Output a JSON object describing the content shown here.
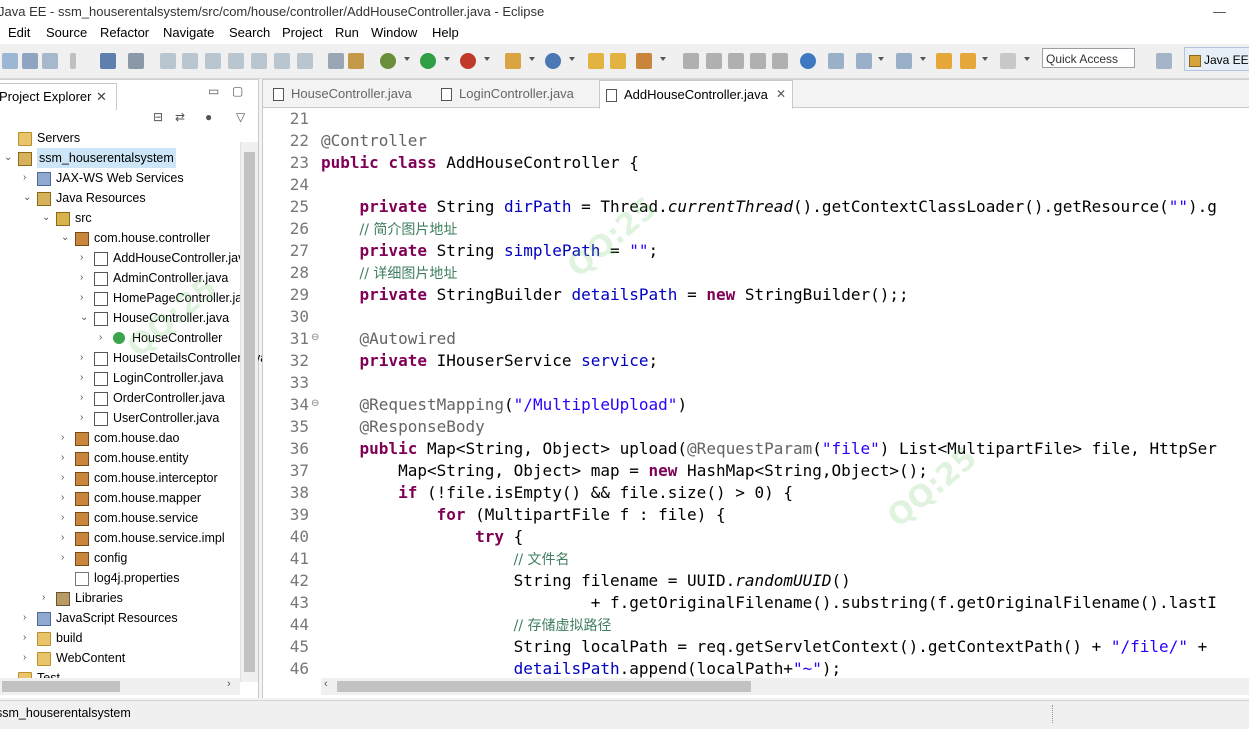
{
  "window": {
    "title": "Java EE - ssm_houserentalsystem/src/com/house/controller/AddHouseController.java - Eclipse"
  },
  "menu": [
    "Edit",
    "Source",
    "Refactor",
    "Navigate",
    "Search",
    "Project",
    "Run",
    "Window",
    "Help"
  ],
  "toolbar": {
    "quick_access_placeholder": "Quick Access",
    "perspective_label": "Java EE"
  },
  "project_explorer": {
    "tab_label": "Project Explorer",
    "tree": [
      {
        "label": "Servers",
        "icon": "folder-icon",
        "depth": 0,
        "expanded": null
      },
      {
        "label": "ssm_houserentalsystem",
        "icon": "project-icon",
        "depth": 0,
        "expanded": true,
        "selected": true
      },
      {
        "label": "JAX-WS Web Services",
        "icon": "webservices-icon",
        "depth": 1,
        "expanded": false
      },
      {
        "label": "Java Resources",
        "icon": "java-resources-icon",
        "depth": 1,
        "expanded": true
      },
      {
        "label": "src",
        "icon": "source-folder-icon",
        "depth": 2,
        "expanded": true
      },
      {
        "label": "com.house.controller",
        "icon": "package-icon",
        "depth": 3,
        "expanded": true
      },
      {
        "label": "AddHouseController.java",
        "icon": "java-file-icon",
        "depth": 4,
        "expanded": false
      },
      {
        "label": "AdminController.java",
        "icon": "java-file-icon",
        "depth": 4,
        "expanded": false
      },
      {
        "label": "HomePageController.java",
        "icon": "java-file-icon",
        "depth": 4,
        "expanded": false
      },
      {
        "label": "HouseController.java",
        "icon": "java-file-icon",
        "depth": 4,
        "expanded": true
      },
      {
        "label": "HouseController",
        "icon": "class-icon",
        "depth": 5,
        "expanded": false
      },
      {
        "label": "HouseDetailsController.java",
        "icon": "java-file-icon",
        "depth": 4,
        "expanded": false
      },
      {
        "label": "LoginController.java",
        "icon": "java-file-icon",
        "depth": 4,
        "expanded": false
      },
      {
        "label": "OrderController.java",
        "icon": "java-file-icon",
        "depth": 4,
        "expanded": false
      },
      {
        "label": "UserController.java",
        "icon": "java-file-icon",
        "depth": 4,
        "expanded": false
      },
      {
        "label": "com.house.dao",
        "icon": "package-icon",
        "depth": 3,
        "expanded": false
      },
      {
        "label": "com.house.entity",
        "icon": "package-icon",
        "depth": 3,
        "expanded": false
      },
      {
        "label": "com.house.interceptor",
        "icon": "package-icon",
        "depth": 3,
        "expanded": false
      },
      {
        "label": "com.house.mapper",
        "icon": "package-icon",
        "depth": 3,
        "expanded": false
      },
      {
        "label": "com.house.service",
        "icon": "package-icon",
        "depth": 3,
        "expanded": false
      },
      {
        "label": "com.house.service.impl",
        "icon": "package-icon",
        "depth": 3,
        "expanded": false
      },
      {
        "label": "config",
        "icon": "package-icon",
        "depth": 3,
        "expanded": false
      },
      {
        "label": "log4j.properties",
        "icon": "properties-file-icon",
        "depth": 3,
        "expanded": null
      },
      {
        "label": "Libraries",
        "icon": "library-icon",
        "depth": 2,
        "expanded": false
      },
      {
        "label": "JavaScript Resources",
        "icon": "javascript-resources-icon",
        "depth": 1,
        "expanded": false
      },
      {
        "label": "build",
        "icon": "folder-icon",
        "depth": 1,
        "expanded": false
      },
      {
        "label": "WebContent",
        "icon": "folder-icon",
        "depth": 1,
        "expanded": false
      },
      {
        "label": "Test",
        "icon": "folder-icon",
        "depth": 0,
        "expanded": null
      }
    ]
  },
  "editor": {
    "tabs": [
      {
        "label": "HouseController.java",
        "active": false
      },
      {
        "label": "LoginController.java",
        "active": false
      },
      {
        "label": "AddHouseController.java",
        "active": true
      }
    ],
    "lines": [
      {
        "n": "21",
        "fold": false,
        "tokens": []
      },
      {
        "n": "22",
        "fold": false,
        "tokens": [
          {
            "t": "an",
            "v": "@Controller"
          }
        ]
      },
      {
        "n": "23",
        "fold": false,
        "tokens": [
          {
            "t": "kw",
            "v": "public"
          },
          {
            "t": "",
            "v": " "
          },
          {
            "t": "kw",
            "v": "class"
          },
          {
            "t": "",
            "v": " AddHouseController {"
          }
        ]
      },
      {
        "n": "24",
        "fold": false,
        "tokens": []
      },
      {
        "n": "25",
        "fold": false,
        "tokens": [
          {
            "t": "",
            "v": "    "
          },
          {
            "t": "kw",
            "v": "private"
          },
          {
            "t": "",
            "v": " String "
          },
          {
            "t": "fd",
            "v": "dirPath"
          },
          {
            "t": "",
            "v": " = Thread."
          },
          {
            "t": "it",
            "v": "currentThread"
          },
          {
            "t": "",
            "v": "().getContextClassLoader().getResource("
          },
          {
            "t": "st",
            "v": "\"\""
          },
          {
            "t": "",
            "v": ").g"
          }
        ]
      },
      {
        "n": "26",
        "fold": false,
        "tokens": [
          {
            "t": "",
            "v": "    "
          },
          {
            "t": "cm",
            "v": "// 简介图片地址"
          }
        ]
      },
      {
        "n": "27",
        "fold": false,
        "tokens": [
          {
            "t": "",
            "v": "    "
          },
          {
            "t": "kw",
            "v": "private"
          },
          {
            "t": "",
            "v": " String "
          },
          {
            "t": "fd",
            "v": "simplePath"
          },
          {
            "t": "",
            "v": " = "
          },
          {
            "t": "st",
            "v": "\"\""
          },
          {
            "t": "",
            "v": ";"
          }
        ]
      },
      {
        "n": "28",
        "fold": false,
        "tokens": [
          {
            "t": "",
            "v": "    "
          },
          {
            "t": "cm",
            "v": "// 详细图片地址"
          }
        ]
      },
      {
        "n": "29",
        "fold": false,
        "tokens": [
          {
            "t": "",
            "v": "    "
          },
          {
            "t": "kw",
            "v": "private"
          },
          {
            "t": "",
            "v": " StringBuilder "
          },
          {
            "t": "fd",
            "v": "detailsPath"
          },
          {
            "t": "",
            "v": " = "
          },
          {
            "t": "kw",
            "v": "new"
          },
          {
            "t": "",
            "v": " StringBuilder();;"
          }
        ]
      },
      {
        "n": "30",
        "fold": false,
        "tokens": []
      },
      {
        "n": "31",
        "fold": true,
        "tokens": [
          {
            "t": "",
            "v": "    "
          },
          {
            "t": "an",
            "v": "@Autowired"
          }
        ]
      },
      {
        "n": "32",
        "fold": false,
        "tokens": [
          {
            "t": "",
            "v": "    "
          },
          {
            "t": "kw",
            "v": "private"
          },
          {
            "t": "",
            "v": " IHouserService "
          },
          {
            "t": "fd",
            "v": "service"
          },
          {
            "t": "",
            "v": ";"
          }
        ]
      },
      {
        "n": "33",
        "fold": false,
        "tokens": []
      },
      {
        "n": "34",
        "fold": true,
        "tokens": [
          {
            "t": "",
            "v": "    "
          },
          {
            "t": "an",
            "v": "@RequestMapping"
          },
          {
            "t": "",
            "v": "("
          },
          {
            "t": "st",
            "v": "\"/MultipleUpload\""
          },
          {
            "t": "",
            "v": ")"
          }
        ]
      },
      {
        "n": "35",
        "fold": false,
        "tokens": [
          {
            "t": "",
            "v": "    "
          },
          {
            "t": "an",
            "v": "@ResponseBody"
          }
        ]
      },
      {
        "n": "36",
        "fold": false,
        "tokens": [
          {
            "t": "",
            "v": "    "
          },
          {
            "t": "kw",
            "v": "public"
          },
          {
            "t": "",
            "v": " Map<String, Object> upload("
          },
          {
            "t": "an",
            "v": "@RequestParam"
          },
          {
            "t": "",
            "v": "("
          },
          {
            "t": "st",
            "v": "\"file\""
          },
          {
            "t": "",
            "v": ") List<MultipartFile> file, HttpSer"
          }
        ]
      },
      {
        "n": "37",
        "fold": false,
        "tokens": [
          {
            "t": "",
            "v": "        Map<String, Object> map = "
          },
          {
            "t": "kw",
            "v": "new"
          },
          {
            "t": "",
            "v": " HashMap<String,Object>();"
          }
        ]
      },
      {
        "n": "38",
        "fold": false,
        "tokens": [
          {
            "t": "",
            "v": "        "
          },
          {
            "t": "kw",
            "v": "if"
          },
          {
            "t": "",
            "v": " (!file.isEmpty() && file.size() > 0) {"
          }
        ]
      },
      {
        "n": "39",
        "fold": false,
        "tokens": [
          {
            "t": "",
            "v": "            "
          },
          {
            "t": "kw",
            "v": "for"
          },
          {
            "t": "",
            "v": " (MultipartFile f : file) {"
          }
        ]
      },
      {
        "n": "40",
        "fold": false,
        "tokens": [
          {
            "t": "",
            "v": "                "
          },
          {
            "t": "kw",
            "v": "try"
          },
          {
            "t": "",
            "v": " {"
          }
        ]
      },
      {
        "n": "41",
        "fold": false,
        "tokens": [
          {
            "t": "",
            "v": "                    "
          },
          {
            "t": "cm",
            "v": "// 文件名"
          }
        ]
      },
      {
        "n": "42",
        "fold": false,
        "tokens": [
          {
            "t": "",
            "v": "                    String filename = UUID."
          },
          {
            "t": "it",
            "v": "randomUUID"
          },
          {
            "t": "",
            "v": "()"
          }
        ]
      },
      {
        "n": "43",
        "fold": false,
        "tokens": [
          {
            "t": "",
            "v": "                            + f.getOriginalFilename().substring(f.getOriginalFilename().lastI"
          }
        ]
      },
      {
        "n": "44",
        "fold": false,
        "tokens": [
          {
            "t": "",
            "v": "                    "
          },
          {
            "t": "cm",
            "v": "// 存储虚拟路径"
          }
        ]
      },
      {
        "n": "45",
        "fold": false,
        "tokens": [
          {
            "t": "",
            "v": "                    String localPath = req.getServletContext().getContextPath() + "
          },
          {
            "t": "st",
            "v": "\"/file/\""
          },
          {
            "t": "",
            "v": " +"
          }
        ]
      },
      {
        "n": "46",
        "fold": false,
        "tokens": [
          {
            "t": "",
            "v": "                    "
          },
          {
            "t": "fd",
            "v": "detailsPath"
          },
          {
            "t": "",
            "v": ".append(localPath+"
          },
          {
            "t": "st",
            "v": "\"~\""
          },
          {
            "t": "",
            "v": ");"
          }
        ]
      }
    ]
  },
  "status_bar": {
    "text": "ssm_houserentalsystem"
  }
}
